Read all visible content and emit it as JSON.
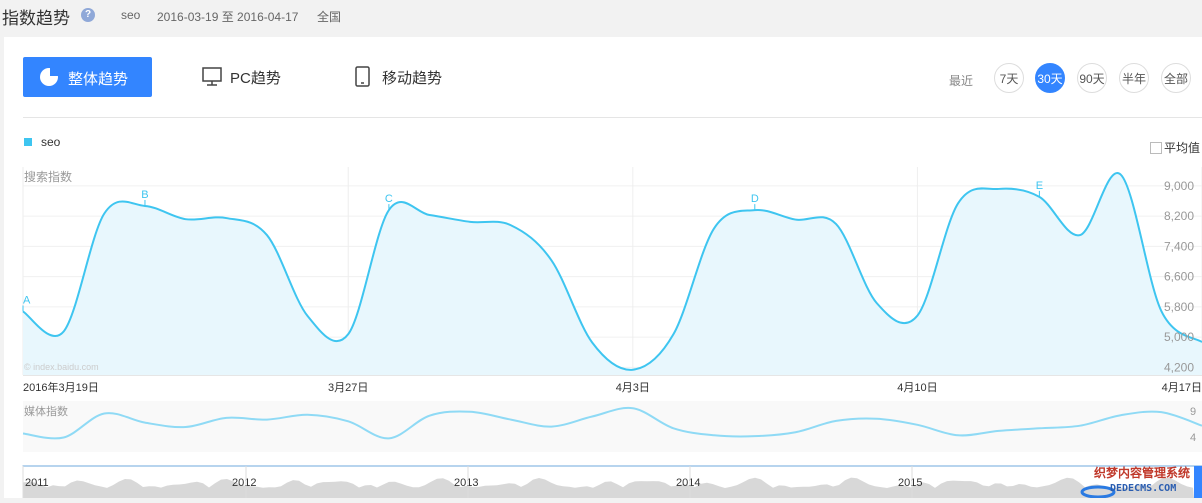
{
  "header": {
    "title": "指数趋势",
    "keyword": "seo",
    "date_range": "2016-03-19 至 2016-04-17",
    "region": "全国"
  },
  "tabs": [
    {
      "label": "整体趋势",
      "active": true
    },
    {
      "label": "PC趋势",
      "active": false
    },
    {
      "label": "移动趋势",
      "active": false
    }
  ],
  "period": {
    "label": "最近",
    "options": [
      "7天",
      "30天",
      "90天",
      "半年",
      "全部"
    ],
    "active": "30天"
  },
  "legend": {
    "series_label": "seo",
    "avg_label": "平均值"
  },
  "search_chart": {
    "ylabel": "搜索指数",
    "watermark": "© index.baidu.com",
    "yticks": [
      "9,000",
      "8,200",
      "7,400",
      "6,600",
      "5,800",
      "5,000",
      "4,200"
    ],
    "xticks": [
      "2016年3月19日",
      "3月27日",
      "4月3日",
      "4月10日",
      "4月17日"
    ],
    "markers": [
      "A",
      "B",
      "C",
      "D",
      "E"
    ]
  },
  "media_chart": {
    "ylabel": "媒体指数",
    "yticks": [
      "9",
      "4"
    ]
  },
  "overview_axis": {
    "years": [
      "2011",
      "2012",
      "2013",
      "2014",
      "2015"
    ]
  },
  "logo_text": "织梦内容管理系统",
  "logo_url_text": "DEDECMS.COM",
  "colors": {
    "accent": "#3385ff",
    "series": "#3ec5f0",
    "area": "#e8f7fd",
    "media_line": "#8fdaf5"
  },
  "chart_data": {
    "type": "area",
    "title": "",
    "ylabel": "搜索指数",
    "ylim": [
      4000,
      9500
    ],
    "x": [
      "2016-03-19",
      "2016-03-20",
      "2016-03-21",
      "2016-03-22",
      "2016-03-23",
      "2016-03-24",
      "2016-03-25",
      "2016-03-26",
      "2016-03-27",
      "2016-03-28",
      "2016-03-29",
      "2016-03-30",
      "2016-03-31",
      "2016-04-01",
      "2016-04-02",
      "2016-04-03",
      "2016-04-04",
      "2016-04-05",
      "2016-04-06",
      "2016-04-07",
      "2016-04-08",
      "2016-04-09",
      "2016-04-10",
      "2016-04-11",
      "2016-04-12",
      "2016-04-13",
      "2016-04-14",
      "2016-04-15",
      "2016-04-16",
      "2016-04-17"
    ],
    "series": [
      {
        "name": "seo",
        "values": [
          5680,
          5150,
          8270,
          8470,
          8120,
          8150,
          7700,
          5560,
          5080,
          8360,
          8230,
          8050,
          7960,
          7030,
          4860,
          4140,
          5080,
          7880,
          8360,
          8110,
          7990,
          5900,
          5570,
          8540,
          8920,
          8710,
          7700,
          9300,
          5690,
          4870
        ]
      }
    ],
    "markers": [
      {
        "label": "A",
        "x": "2016-03-19"
      },
      {
        "label": "B",
        "x": "2016-03-22"
      },
      {
        "label": "C",
        "x": "2016-03-28"
      },
      {
        "label": "D",
        "x": "2016-04-06"
      },
      {
        "label": "E",
        "x": "2016-04-13"
      }
    ],
    "media_series": {
      "name": "媒体指数",
      "ylim": [
        0,
        11
      ],
      "values": [
        4.0,
        3.1,
        8.6,
        6.5,
        5.5,
        7.6,
        7.2,
        8.3,
        6.8,
        2.9,
        8.1,
        9.0,
        7.2,
        5.6,
        7.9,
        9.8,
        5.2,
        3.6,
        3.4,
        4.3,
        6.9,
        7.4,
        6.0,
        3.6,
        4.6,
        5.2,
        5.8,
        8.2,
        8.9,
        5.8
      ]
    }
  }
}
